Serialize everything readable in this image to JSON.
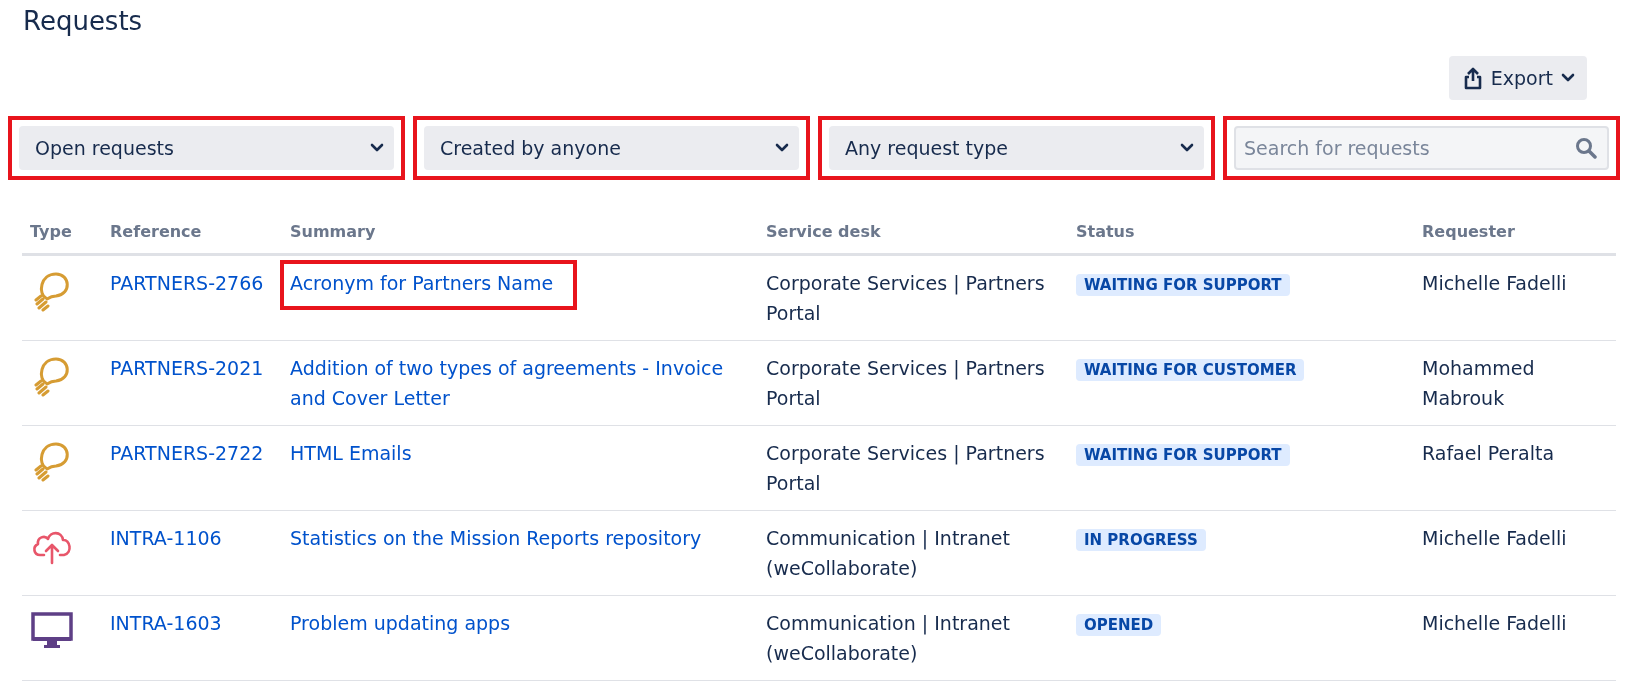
{
  "title": "Requests",
  "export_button": {
    "label": "Export"
  },
  "filters": [
    {
      "kind": "select",
      "value": "Open requests",
      "highlighted": true
    },
    {
      "kind": "select",
      "value": "Created by anyone",
      "highlighted": true
    },
    {
      "kind": "select",
      "value": "Any request type",
      "highlighted": true
    },
    {
      "kind": "search",
      "placeholder": "Search for requests",
      "highlighted": true
    }
  ],
  "table": {
    "columns": [
      "Type",
      "Reference",
      "Summary",
      "Service desk",
      "Status",
      "Requester"
    ],
    "rows": [
      {
        "kind": "idea",
        "reference": "PARTNERS-2766",
        "summary": "Acronym for Partners Name",
        "summary_highlighted": true,
        "service_desk": "Corporate Services | Partners Portal",
        "status": "WAITING FOR SUPPORT",
        "requester": "Michelle Fadelli"
      },
      {
        "kind": "idea",
        "reference": "PARTNERS-2021",
        "summary": "Addition of two types of agreements - Invoice and Cover Letter",
        "summary_highlighted": false,
        "service_desk": "Corporate Services | Partners Portal",
        "status": "WAITING FOR CUSTOMER",
        "requester": "Mohammed Mabrouk"
      },
      {
        "kind": "idea",
        "reference": "PARTNERS-2722",
        "summary": "HTML Emails",
        "summary_highlighted": false,
        "service_desk": "Corporate Services | Partners Portal",
        "status": "WAITING FOR SUPPORT",
        "requester": "Rafael Peralta"
      },
      {
        "kind": "cloud",
        "reference": "INTRA-1106",
        "summary": "Statistics on the Mission Reports repository",
        "summary_highlighted": false,
        "service_desk": "Communication | Intranet (weCollaborate)",
        "status": "IN PROGRESS",
        "requester": "Michelle Fadelli"
      },
      {
        "kind": "monitor",
        "reference": "INTRA-1603",
        "summary": "Problem updating apps",
        "summary_highlighted": false,
        "service_desk": "Communication | Intranet (weCollaborate)",
        "status": "OPENED",
        "requester": "Michelle Fadelli"
      }
    ]
  }
}
